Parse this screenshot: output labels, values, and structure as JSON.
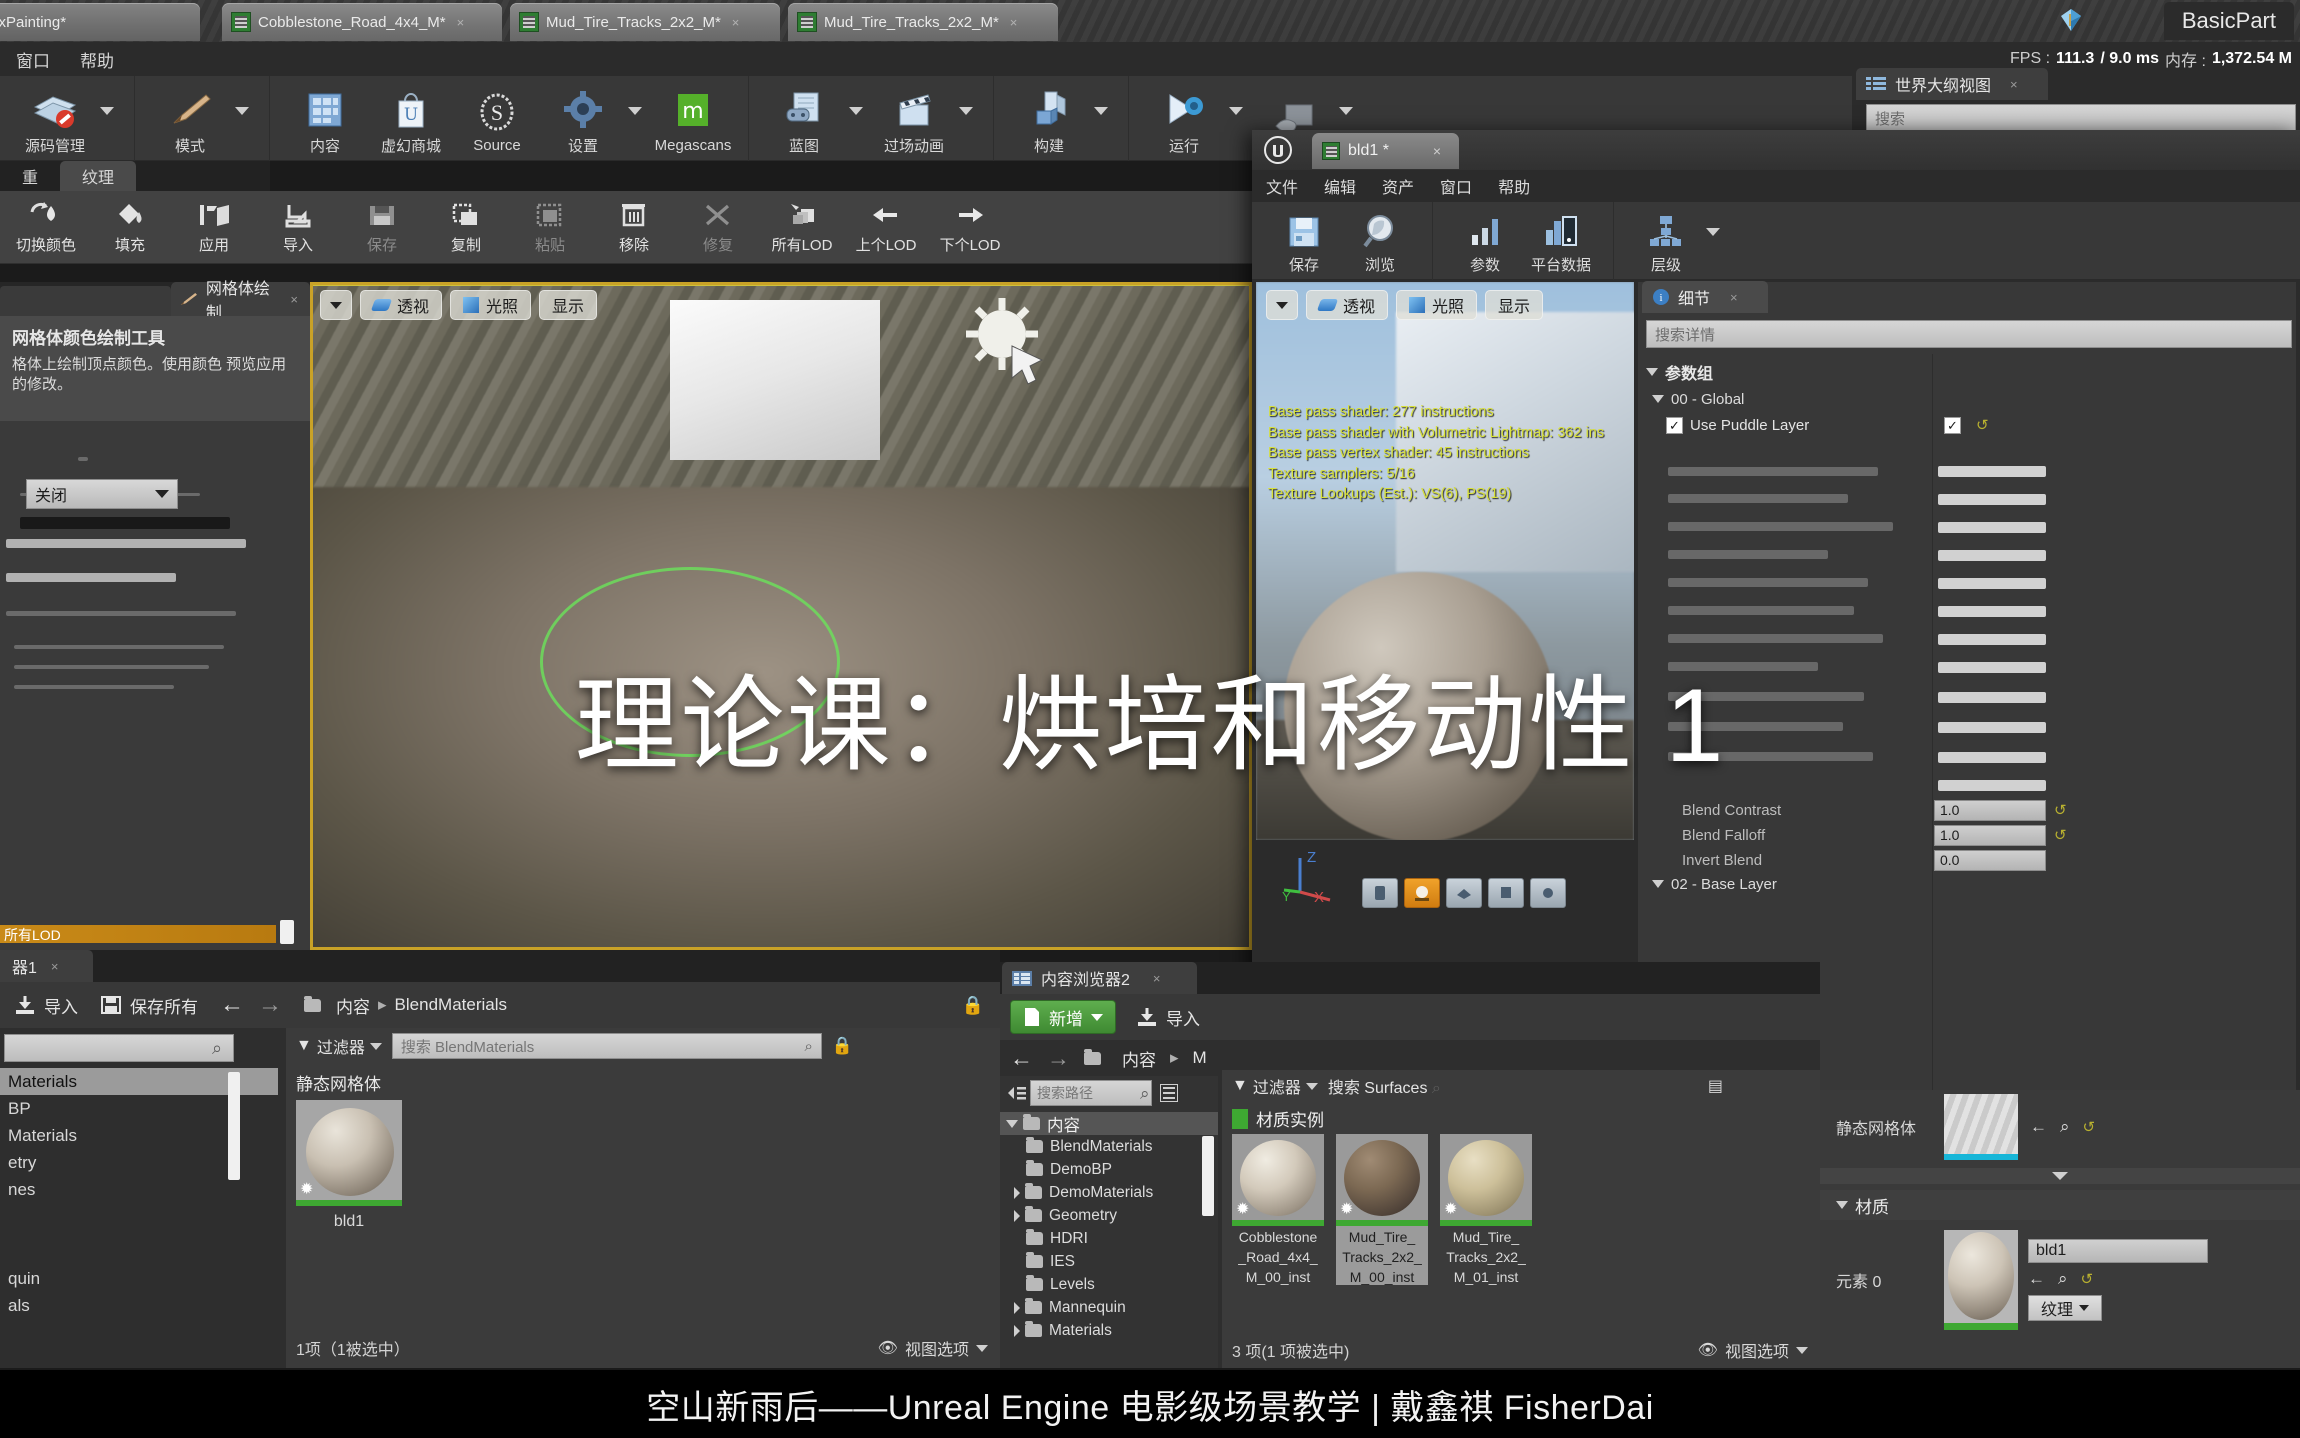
{
  "window": {
    "tabs": [
      {
        "label": "rtexPainting*"
      },
      {
        "label": "Cobblestone_Road_4x4_M*"
      },
      {
        "label": "Mud_Tire_Tracks_2x2_M*"
      },
      {
        "label": "Mud_Tire_Tracks_2x2_M*"
      }
    ],
    "basic_part": "BasicPart"
  },
  "menubar": {
    "items": [
      "窗口",
      "帮助"
    ]
  },
  "stats": {
    "fps_label": "FPS :",
    "fps_value": "111.3",
    "ms_value": "/ 9.0 ms",
    "mem_label": "内存 :",
    "mem_value": "1,372.54 M"
  },
  "main_toolbar": {
    "groups": [
      {
        "items": [
          {
            "label": "源码管理",
            "icon": "source-control-icon",
            "caret": true
          }
        ]
      },
      {
        "items": [
          {
            "label": "模式",
            "icon": "brush-icon",
            "caret": true
          }
        ]
      },
      {
        "items": [
          {
            "label": "内容",
            "icon": "content-icon",
            "caret": false
          },
          {
            "label": "虚幻商城",
            "icon": "marketplace-icon",
            "caret": false
          },
          {
            "label": "Source",
            "icon": "source-icon",
            "caret": false
          },
          {
            "label": "设置",
            "icon": "settings-gear-icon",
            "caret": true
          },
          {
            "label": "Megascans",
            "icon": "megascans-icon",
            "caret": false
          }
        ]
      },
      {
        "items": [
          {
            "label": "蓝图",
            "icon": "blueprint-icon",
            "caret": true
          },
          {
            "label": "过场动画",
            "icon": "cinematics-icon",
            "caret": true
          }
        ]
      },
      {
        "items": [
          {
            "label": "构建",
            "icon": "build-icon",
            "caret": true
          }
        ]
      },
      {
        "items": [
          {
            "label": "运行",
            "icon": "play-icon",
            "caret": true
          },
          {
            "label": "",
            "icon": "launch-icon",
            "caret": true
          }
        ]
      }
    ]
  },
  "texture_panel": {
    "tabs": [
      {
        "label": "重",
        "active": false
      },
      {
        "label": "纹理",
        "active": true
      }
    ],
    "tools": [
      {
        "label": "切换颜色",
        "icon": "swap-colors-icon",
        "dim": false
      },
      {
        "label": "填充",
        "icon": "fill-bucket-icon",
        "dim": false
      },
      {
        "label": "应用",
        "icon": "apply-icon",
        "dim": false
      },
      {
        "label": "导入",
        "icon": "import-icon",
        "dim": false
      },
      {
        "label": "保存",
        "icon": "save-icon",
        "dim": true
      },
      {
        "label": "复制",
        "icon": "copy-icon",
        "dim": false
      },
      {
        "label": "粘贴",
        "icon": "paste-icon",
        "dim": true
      },
      {
        "label": "移除",
        "icon": "trash-icon",
        "dim": false
      },
      {
        "label": "修复",
        "icon": "repair-icon",
        "dim": true
      },
      {
        "label": "所有LOD",
        "icon": "all-lod-icon",
        "dim": false
      },
      {
        "label": "上个LOD",
        "icon": "arrow-left-icon",
        "dim": false
      },
      {
        "label": "下个LOD",
        "icon": "arrow-right-icon",
        "dim": false
      }
    ],
    "dock_tab": "网格体绘制",
    "panel_title": "网格体颜色绘制工具",
    "panel_desc": "格体上绘制顶点颜色。使用颜色 预览应用的修改。",
    "combo_value": "关闭",
    "lod_bar": "所有LOD"
  },
  "viewport": {
    "buttons": [
      {
        "label": "",
        "icon": "chevron-down-icon"
      },
      {
        "label": "透视",
        "icon": "perspective-icon"
      },
      {
        "label": "光照",
        "icon": "lit-cube-icon"
      },
      {
        "label": "显示",
        "icon": "display-icon"
      }
    ]
  },
  "outliner": {
    "tab": "世界大纲视图",
    "search_placeholder": "搜索"
  },
  "child_window": {
    "tab": "bld1 *",
    "menubar": [
      "文件",
      "编辑",
      "资产",
      "窗口",
      "帮助"
    ],
    "toolbar": [
      {
        "label": "保存",
        "icon": "save-floppy-icon",
        "caret": false
      },
      {
        "label": "浏览",
        "icon": "browse-magnifier-icon",
        "caret": false
      },
      {
        "label": "参数",
        "icon": "parameters-icon",
        "caret": false
      },
      {
        "label": "平台数据",
        "icon": "platform-stats-icon",
        "caret": false
      },
      {
        "label": "层级",
        "icon": "hierarchy-icon",
        "caret": true
      }
    ],
    "viewport_buttons": [
      {
        "label": "",
        "icon": "chevron-down-icon"
      },
      {
        "label": "透视",
        "icon": "perspective-icon"
      },
      {
        "label": "光照",
        "icon": "lit-cube-icon"
      },
      {
        "label": "显示",
        "icon": "display-icon"
      }
    ],
    "shader_stats": [
      "Base pass shader: 277 instructions",
      "Base pass shader with Volumetric Lightmap: 362 ins",
      "Base pass vertex shader: 45 instructions",
      "Texture samplers: 5/16",
      "Texture Lookups (Est.): VS(6), PS(19)"
    ],
    "axis": {
      "x": "X",
      "y": "Y",
      "z": "Z"
    },
    "details": {
      "tab": "细节",
      "search_placeholder": "搜索详情",
      "groups": [
        {
          "label": "参数组",
          "level": 0
        },
        {
          "label": "00 - Global",
          "level": 1
        }
      ],
      "checkbox_row": {
        "label": "Use Puddle Layer",
        "checked": true,
        "value_checked": true
      },
      "blend_rows": [
        {
          "label": "Blend Contrast",
          "value": "1.0",
          "reset": true
        },
        {
          "label": "Blend Falloff",
          "value": "1.0",
          "reset": true
        },
        {
          "label": "Invert Blend",
          "value": "0.0",
          "reset": false
        }
      ],
      "base_layer_group": "02 - Base Layer"
    }
  },
  "content_browser_1": {
    "tab": "器1",
    "toolbar": [
      {
        "label": "导入",
        "icon": "import-icon"
      },
      {
        "label": "保存所有",
        "icon": "save-all-icon"
      }
    ],
    "nav": {
      "back": "arrow-left-icon",
      "forward": "arrow-right-icon"
    },
    "breadcrumb": [
      "内容",
      "BlendMaterials"
    ],
    "search_placeholder": "",
    "filter_label": "过滤器",
    "asset_search_placeholder": "搜索 BlendMaterials",
    "tree_items": [
      {
        "label": "Materials",
        "selected": true
      },
      {
        "label": "BP",
        "selected": false
      },
      {
        "label": "Materials",
        "selected": false
      },
      {
        "label": "etry",
        "selected": false
      },
      {
        "label": "nes",
        "selected": false
      },
      {
        "label": "quin",
        "selected": false
      },
      {
        "label": "als",
        "selected": false
      }
    ],
    "category": "静态网格体",
    "assets": [
      {
        "name": "bld1"
      }
    ],
    "footer": "1项（1被选中）",
    "view_options": "视图选项"
  },
  "content_browser_2": {
    "tab": "内容浏览器2",
    "new_button": "新增",
    "import_button": "导入",
    "nav_breadcrumb": [
      "内容",
      "M"
    ],
    "path_search_placeholder": "搜索路径",
    "tree": [
      {
        "label": "内容",
        "level": 0,
        "expander": "open"
      },
      {
        "label": "BlendMaterials",
        "level": 1,
        "expander": "none"
      },
      {
        "label": "DemoBP",
        "level": 1,
        "expander": "none"
      },
      {
        "label": "DemoMaterials",
        "level": 1,
        "expander": "closed"
      },
      {
        "label": "Geometry",
        "level": 1,
        "expander": "closed"
      },
      {
        "label": "HDRI",
        "level": 1,
        "expander": "none"
      },
      {
        "label": "IES",
        "level": 1,
        "expander": "none"
      },
      {
        "label": "Levels",
        "level": 1,
        "expander": "none"
      },
      {
        "label": "Mannequin",
        "level": 1,
        "expander": "closed"
      },
      {
        "label": "Materials",
        "level": 1,
        "expander": "closed"
      }
    ],
    "filter_label": "过滤器",
    "asset_search_placeholder": "搜索 Surfaces",
    "category": "材质实例",
    "assets": [
      {
        "name": "Cobblestone_Road_4x4_M_00_inst",
        "lines": [
          "Cobblestone",
          "_Road_4x4_",
          "M_00_inst"
        ],
        "selected": false
      },
      {
        "name": "Mud_Tire_Tracks_2x2_M_00_inst",
        "lines": [
          "Mud_Tire_",
          "Tracks_2x2_",
          "M_00_inst"
        ],
        "selected": true
      },
      {
        "name": "Mud_Tire_Tracks_2x2_M_01_inst",
        "lines": [
          "Mud_Tire_",
          "Tracks_2x2_",
          "M_01_inst"
        ],
        "selected": false
      }
    ],
    "footer": "3 项(1 项被选中)",
    "view_options": "视图选项"
  },
  "right_bottom_details": {
    "static_mesh_label": "静态网格体",
    "material_group": "材质",
    "element_label": "元素 0",
    "material_value": "bld1",
    "texture_button": "纹理"
  },
  "overlay": {
    "title": "理论课：烘培和移动性 1"
  },
  "caption": {
    "text": "空山新雨后——Unreal Engine 电影级场景教学 | 戴鑫祺 FisherDai"
  },
  "colors": {
    "accent_green": "#3ea832",
    "accent_orange": "#d07c10",
    "select_yellow": "#c9a227",
    "shader_text": "#d8e03a",
    "panel_bg": "#383838"
  }
}
